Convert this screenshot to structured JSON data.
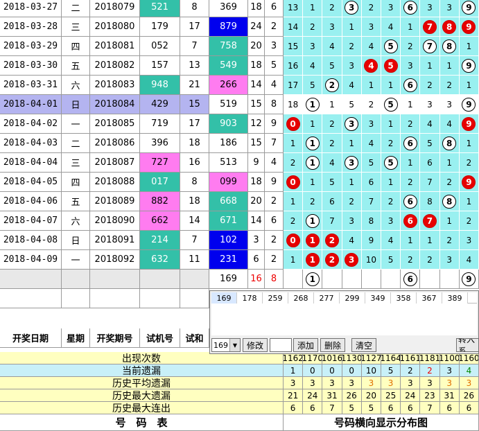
{
  "colors": {
    "teal": "#33c0a8",
    "pink": "#ff7cf0",
    "blue": "#0000ee",
    "highlight": "#b4b4f0",
    "dist": "#99f0f0",
    "yellow_row": "#ffffc0",
    "red_ball": "#e60000"
  },
  "rows": [
    {
      "date": "2018-03-27",
      "week": "二",
      "issue": "2018079",
      "test": "521",
      "sum": "8",
      "draw": "369",
      "s": "18",
      "k": "6",
      "dist": [
        "13",
        "1",
        "2",
        "3",
        "2",
        "3",
        "6",
        "3",
        "3",
        "9"
      ],
      "balls": [
        3,
        6,
        9
      ],
      "red": [],
      "test_bg": "teal",
      "draw_bg": "none"
    },
    {
      "date": "2018-03-28",
      "week": "三",
      "issue": "2018080",
      "test": "179",
      "sum": "17",
      "draw": "879",
      "s": "24",
      "k": "2",
      "dist": [
        "14",
        "2",
        "3",
        "1",
        "3",
        "4",
        "1",
        "7",
        "8",
        "9"
      ],
      "balls": [
        7,
        8,
        9
      ],
      "red": [
        7,
        8,
        9
      ],
      "test_bg": "none",
      "draw_bg": "blue"
    },
    {
      "date": "2018-03-29",
      "week": "四",
      "issue": "2018081",
      "test": "052",
      "sum": "7",
      "draw": "758",
      "s": "20",
      "k": "3",
      "dist": [
        "15",
        "3",
        "4",
        "2",
        "4",
        "5",
        "2",
        "7",
        "8",
        "1"
      ],
      "balls": [
        5,
        7,
        8
      ],
      "red": [],
      "test_bg": "none",
      "draw_bg": "teal"
    },
    {
      "date": "2018-03-30",
      "week": "五",
      "issue": "2018082",
      "test": "157",
      "sum": "13",
      "draw": "549",
      "s": "18",
      "k": "5",
      "dist": [
        "16",
        "4",
        "5",
        "3",
        "4",
        "5",
        "3",
        "1",
        "1",
        "9"
      ],
      "balls": [
        4,
        5,
        9
      ],
      "red": [
        4,
        5
      ],
      "test_bg": "none",
      "draw_bg": "teal"
    },
    {
      "date": "2018-03-31",
      "week": "六",
      "issue": "2018083",
      "test": "948",
      "sum": "21",
      "draw": "266",
      "s": "14",
      "k": "4",
      "dist": [
        "17",
        "5",
        "2",
        "4",
        "1",
        "1",
        "6",
        "2",
        "2",
        "1"
      ],
      "balls": [
        2,
        6
      ],
      "red": [],
      "test_bg": "teal",
      "draw_bg": "pink"
    },
    {
      "date": "2018-04-01",
      "week": "日",
      "issue": "2018084",
      "test": "429",
      "sum": "15",
      "draw": "519",
      "s": "15",
      "k": "8",
      "dist": [
        "18",
        "1",
        "1",
        "5",
        "2",
        "5",
        "1",
        "3",
        "3",
        "9"
      ],
      "balls": [
        1,
        5,
        9
      ],
      "red": [],
      "test_bg": "none",
      "draw_bg": "none",
      "hl": true
    },
    {
      "date": "2018-04-02",
      "week": "一",
      "issue": "2018085",
      "test": "719",
      "sum": "17",
      "draw": "903",
      "s": "12",
      "k": "9",
      "dist": [
        "0",
        "1",
        "2",
        "3",
        "3",
        "1",
        "2",
        "4",
        "4",
        "9"
      ],
      "balls": [
        0,
        3,
        9
      ],
      "red": [
        0,
        9
      ],
      "test_bg": "none",
      "draw_bg": "teal"
    },
    {
      "date": "2018-04-03",
      "week": "二",
      "issue": "2018086",
      "test": "396",
      "sum": "18",
      "draw": "186",
      "s": "15",
      "k": "7",
      "dist": [
        "1",
        "1",
        "2",
        "1",
        "4",
        "2",
        "6",
        "5",
        "8",
        "1"
      ],
      "balls": [
        1,
        6,
        8
      ],
      "red": [],
      "test_bg": "none",
      "draw_bg": "none"
    },
    {
      "date": "2018-04-04",
      "week": "三",
      "issue": "2018087",
      "test": "727",
      "sum": "16",
      "draw": "513",
      "s": "9",
      "k": "4",
      "dist": [
        "2",
        "1",
        "4",
        "3",
        "5",
        "5",
        "1",
        "6",
        "1",
        "2"
      ],
      "balls": [
        1,
        3,
        5
      ],
      "red": [],
      "test_bg": "pink",
      "draw_bg": "none"
    },
    {
      "date": "2018-04-05",
      "week": "四",
      "issue": "2018088",
      "test": "017",
      "sum": "8",
      "draw": "099",
      "s": "18",
      "k": "9",
      "dist": [
        "0",
        "1",
        "5",
        "1",
        "6",
        "1",
        "2",
        "7",
        "2",
        "9"
      ],
      "balls": [
        0,
        9
      ],
      "red": [
        0,
        9
      ],
      "test_bg": "teal",
      "draw_bg": "pink"
    },
    {
      "date": "2018-04-06",
      "week": "五",
      "issue": "2018089",
      "test": "882",
      "sum": "18",
      "draw": "668",
      "s": "20",
      "k": "2",
      "dist": [
        "1",
        "2",
        "6",
        "2",
        "7",
        "2",
        "6",
        "8",
        "8",
        "1"
      ],
      "balls": [
        6,
        8
      ],
      "red": [],
      "test_bg": "pink",
      "draw_bg": "teal"
    },
    {
      "date": "2018-04-07",
      "week": "六",
      "issue": "2018090",
      "test": "662",
      "sum": "14",
      "draw": "671",
      "s": "14",
      "k": "6",
      "dist": [
        "2",
        "1",
        "7",
        "3",
        "8",
        "3",
        "6",
        "7",
        "1",
        "2"
      ],
      "balls": [
        1,
        6,
        7
      ],
      "red": [
        6,
        7
      ],
      "test_bg": "pink",
      "draw_bg": "teal"
    },
    {
      "date": "2018-04-08",
      "week": "日",
      "issue": "2018091",
      "test": "214",
      "sum": "7",
      "draw": "102",
      "s": "3",
      "k": "2",
      "dist": [
        "0",
        "1",
        "2",
        "4",
        "9",
        "4",
        "1",
        "1",
        "2",
        "3"
      ],
      "balls": [
        0,
        1,
        2
      ],
      "red": [
        0,
        1,
        2
      ],
      "test_bg": "teal",
      "draw_bg": "blue"
    },
    {
      "date": "2018-04-09",
      "week": "一",
      "issue": "2018092",
      "test": "632",
      "sum": "11",
      "draw": "231",
      "s": "6",
      "k": "2",
      "dist": [
        "1",
        "1",
        "2",
        "3",
        "10",
        "5",
        "2",
        "2",
        "3",
        "4"
      ],
      "balls": [
        1,
        2,
        3
      ],
      "red": [
        1,
        2,
        3
      ],
      "test_bg": "teal",
      "draw_bg": "blue"
    }
  ],
  "pred": {
    "draw": "169",
    "s": "16",
    "k": "8",
    "balls": [
      1,
      6,
      9
    ]
  },
  "headers": {
    "date": "开奖日期",
    "week": "星期",
    "issue": "开奖期号",
    "test": "试机号",
    "sum": "试和"
  },
  "panel": {
    "tabs": [
      "169",
      "178",
      "259",
      "268",
      "277",
      "299",
      "349",
      "358",
      "367",
      "389"
    ],
    "select_value": "169",
    "buttons": {
      "modify": "修改",
      "add": "添加",
      "delete": "删除",
      "clear": "清空",
      "import": "转入系"
    }
  },
  "stats": [
    {
      "label": "出现次数",
      "values": [
        "1162",
        "1170",
        "1016",
        "1130",
        "1127",
        "1164",
        "1161",
        "1181",
        "1100",
        "1160"
      ]
    },
    {
      "label": "当前遗漏",
      "values": [
        "1",
        "0",
        "0",
        "0",
        "10",
        "5",
        "2",
        "2",
        "3",
        "4"
      ]
    },
    {
      "label": "历史平均遗漏",
      "values": [
        "3",
        "3",
        "3",
        "3",
        "3",
        "3",
        "3",
        "3",
        "3",
        "3"
      ]
    },
    {
      "label": "历史最大遗漏",
      "values": [
        "21",
        "24",
        "31",
        "26",
        "20",
        "25",
        "24",
        "23",
        "31",
        "26"
      ]
    },
    {
      "label": "历史最大连出",
      "values": [
        "6",
        "6",
        "7",
        "5",
        "5",
        "6",
        "6",
        "7",
        "6",
        "6"
      ]
    }
  ],
  "bottom": {
    "left": "号　码　表",
    "right": "号码横向显示分布图"
  }
}
